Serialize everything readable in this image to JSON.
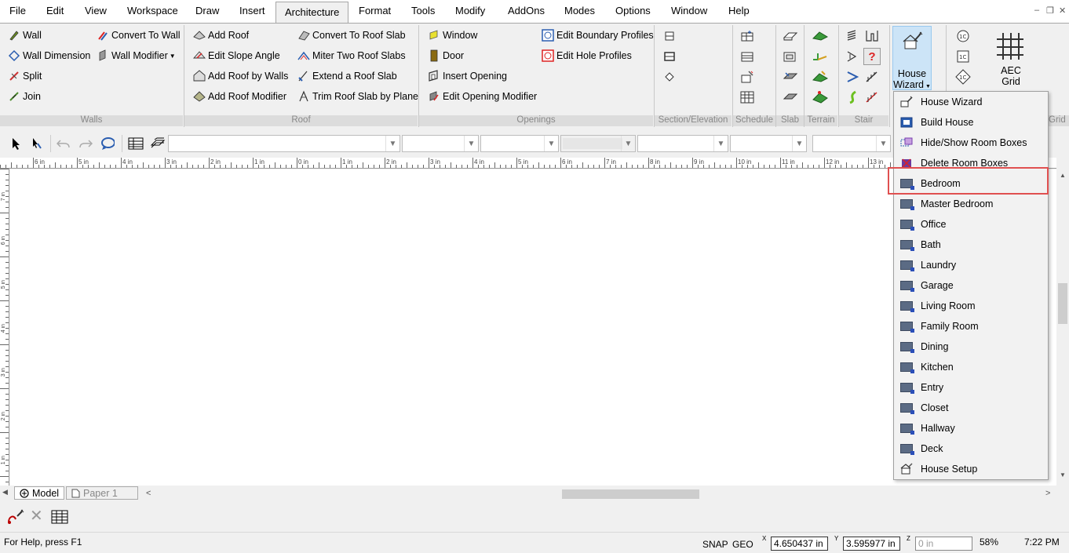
{
  "menu": {
    "items": [
      "File",
      "Edit",
      "View",
      "Workspace",
      "Draw",
      "Insert",
      "Architecture",
      "Format",
      "Tools",
      "Modify",
      "AddOns",
      "Modes",
      "Options",
      "Window",
      "Help"
    ],
    "active": "Architecture"
  },
  "ribbon": {
    "walls": {
      "label": "Walls",
      "buttons": [
        "Wall",
        "Wall Dimension",
        "Split",
        "Join",
        "Convert To Wall",
        "Wall Modifier"
      ]
    },
    "roof": {
      "label": "Roof",
      "buttons": [
        "Add Roof",
        "Edit Slope Angle",
        "Add Roof by Walls",
        "Add Roof Modifier",
        "Convert To Roof Slab",
        "Miter Two Roof Slabs",
        "Extend a Roof Slab",
        "Trim Roof Slab by Plane"
      ]
    },
    "openings": {
      "label": "Openings",
      "buttons": [
        "Window",
        "Door",
        "Insert Opening",
        "Edit Opening Modifier",
        "Edit Boundary Profiles",
        "Edit Hole Profiles"
      ]
    },
    "section_elevation": {
      "label": "Section/Elevation"
    },
    "schedule": {
      "label": "Schedule"
    },
    "slab": {
      "label": "Slab"
    },
    "terrain": {
      "label": "Terrain"
    },
    "stair": {
      "label": "Stair"
    },
    "grid": {
      "label": "Grid"
    },
    "house_wizard": {
      "line1": "House",
      "line2": "Wizard"
    },
    "aec_grid": {
      "line1": "AEC",
      "line2": "Grid"
    }
  },
  "ruler": {
    "h_labels": [
      "6 in",
      "5 in",
      "4 in",
      "3 in",
      "2 in",
      "1 in",
      "0 in",
      "1 in",
      "2 in",
      "3 in",
      "4 in",
      "5 in",
      "6 in",
      "7 in",
      "8 in",
      "9 in",
      "10 in",
      "11 in",
      "12 in",
      "13 in"
    ],
    "v_labels": [
      "7 in",
      "6 in",
      "5 in",
      "4 in",
      "3 in",
      "2 in",
      "1 in"
    ]
  },
  "tabs": {
    "model": "Model",
    "paper": "Paper 1"
  },
  "status": {
    "help": "For Help, press F1",
    "snap": "SNAP",
    "geo": "GEO",
    "x_label": "X",
    "y_label": "Y",
    "z_label": "Z",
    "x": "4.650437 in",
    "y": "3.595977 in",
    "z": "0 in",
    "zoom": "58%",
    "time": "7:22 PM"
  },
  "dropdown": {
    "items": [
      "House Wizard",
      "Build House",
      "Hide/Show Room Boxes",
      "Delete Room Boxes",
      "Bedroom",
      "Master Bedroom",
      "Office",
      "Bath",
      "Laundry",
      "Garage",
      "Living Room",
      "Family Room",
      "Dining",
      "Kitchen",
      "Entry",
      "Closet",
      "Hallway",
      "Deck",
      "House Setup"
    ],
    "highlighted": "Bedroom"
  },
  "colors": {
    "accent_blue": "#cce4f7",
    "highlight_red": "#e05050"
  }
}
